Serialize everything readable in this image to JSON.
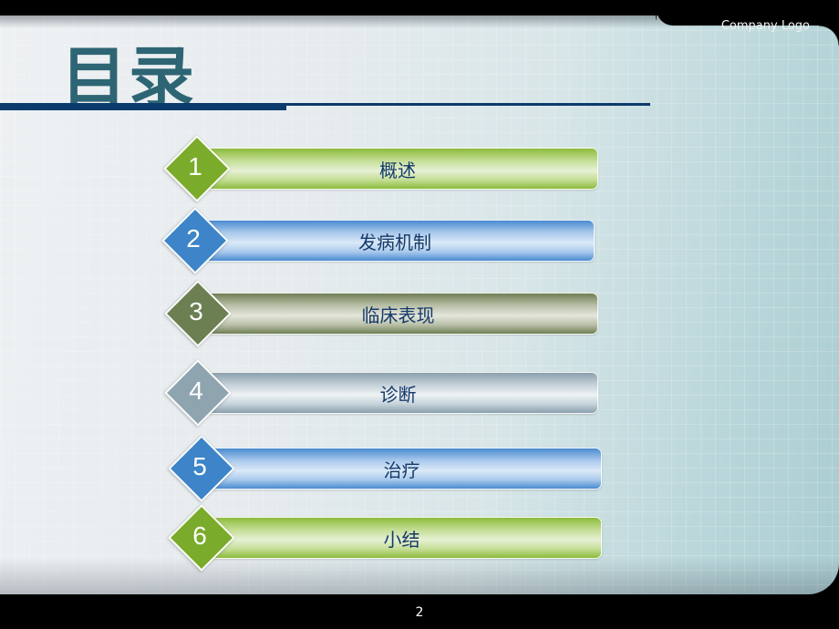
{
  "header": {
    "company_logo": "Company Logo",
    "title": "目录"
  },
  "toc": {
    "items": [
      {
        "number": "1",
        "label": "概述",
        "color_theme": "green",
        "color": "#7aab2a"
      },
      {
        "number": "2",
        "label": "发病机制",
        "color_theme": "blue",
        "color": "#3d85c8"
      },
      {
        "number": "3",
        "label": "临床表现",
        "color_theme": "olive",
        "color": "#6b7f52"
      },
      {
        "number": "4",
        "label": "诊断",
        "color_theme": "grey",
        "color": "#8ea5b0"
      },
      {
        "number": "5",
        "label": "治疗",
        "color_theme": "blue",
        "color": "#3d85c8"
      },
      {
        "number": "6",
        "label": "小结",
        "color_theme": "green",
        "color": "#7aab2a"
      }
    ]
  },
  "footer": {
    "page_number": "2"
  },
  "colors": {
    "title": "#2e6574",
    "rule": "#0b3a6c",
    "item_text": "#153a6a"
  }
}
